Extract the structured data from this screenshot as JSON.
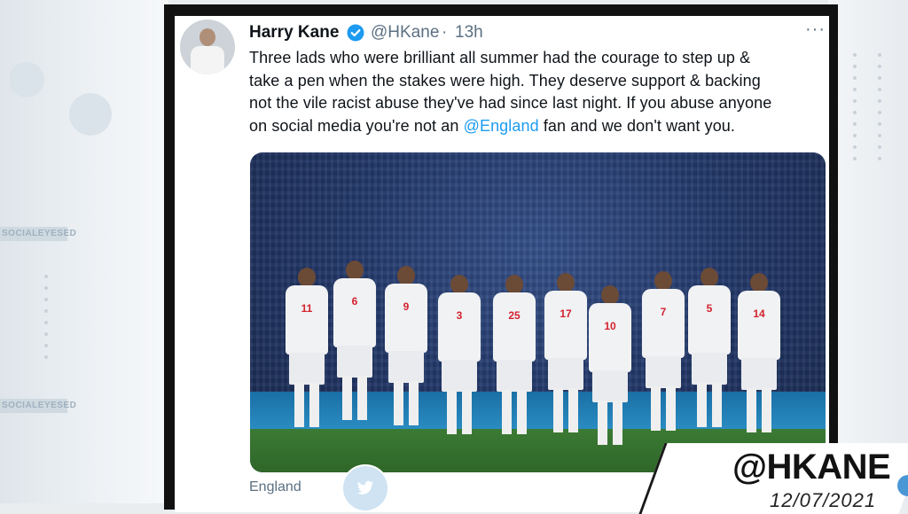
{
  "background": {
    "tags": [
      "SOCIALEYESED",
      "SOCIALEYESED"
    ]
  },
  "tweet": {
    "author_name": "Harry Kane",
    "handle": "@HKane",
    "separator": "·",
    "time": "13h",
    "more": "···",
    "lines": [
      "Three lads who were brilliant all summer had the courage to step up &",
      "take a pen when the stakes were high. They deserve support & backing",
      "not the vile racist abuse they've had since last night. If you abuse anyone"
    ],
    "last_line_before": "on social media you're not an ",
    "mention": "@England",
    "last_line_after": " fan and we don't want you.",
    "source": "England",
    "player_numbers": [
      "11",
      "6",
      "9",
      "3",
      "25",
      "17",
      "10",
      "7",
      "5",
      "14"
    ]
  },
  "overlay": {
    "handle": "@HKANE",
    "date": "12/07/2021"
  },
  "colors": {
    "link": "#1d9bf0",
    "text": "#0f1419",
    "muted": "#5b7083",
    "verified": "#1d9bf0"
  }
}
